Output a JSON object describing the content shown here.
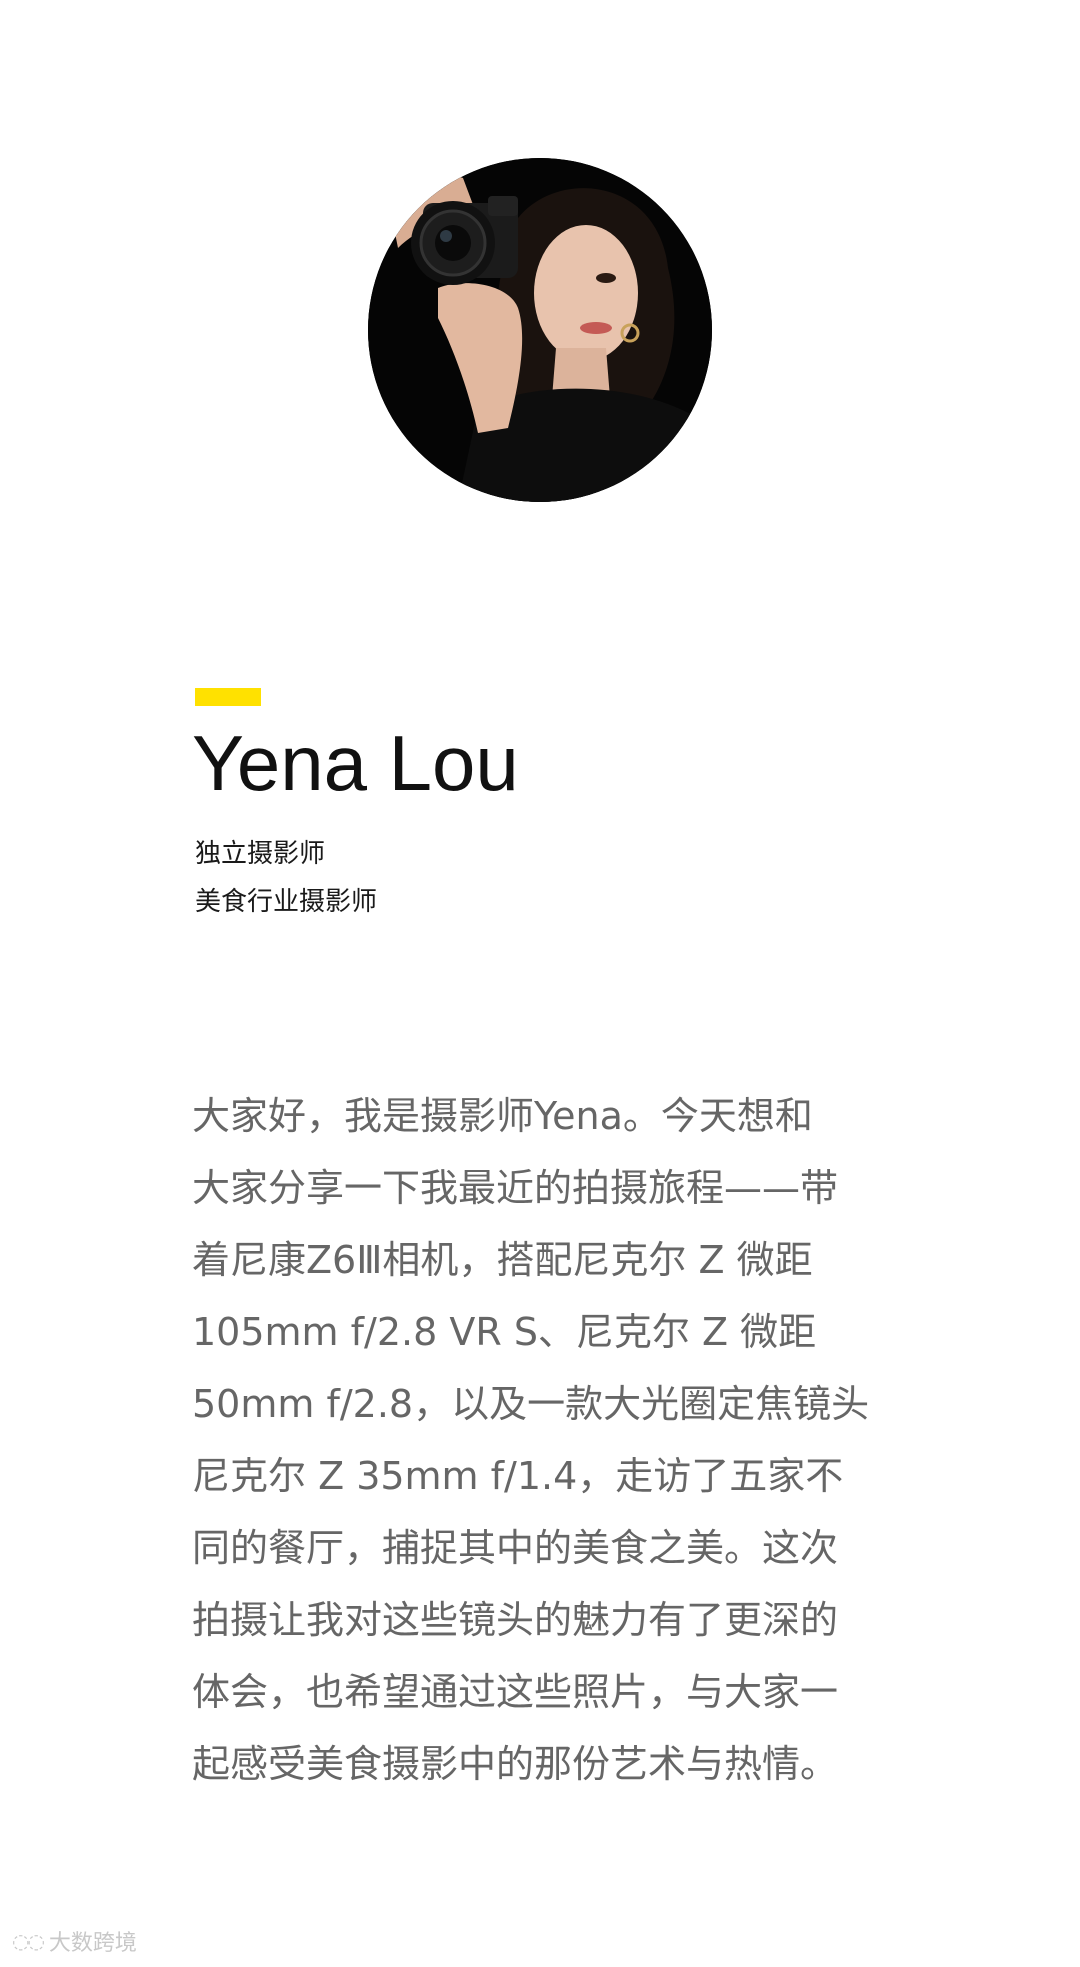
{
  "profile": {
    "name": "Yena Lou",
    "roles": [
      "独立摄影师",
      "美食行业摄影师"
    ],
    "accent_color": "#ffe100"
  },
  "intro": {
    "lines": [
      "大家好，我是摄影师Yena。今天想和",
      "大家分享一下我最近的拍摄旅程——带",
      "着尼康Z6Ⅲ相机，搭配尼克尔 Z 微距",
      "105mm f/2.8 VR S、尼克尔 Z 微距",
      "50mm f/2.8，以及一款大光圈定焦镜头",
      "尼克尔 Z 35mm f/1.4，走访了五家不",
      "同的餐厅，捕捉其中的美食之美。这次",
      "拍摄让我对这些镜头的魅力有了更深的",
      "体会，也希望通过这些照片，与大家一",
      "起感受美食摄影中的那份艺术与热情。"
    ]
  },
  "watermark": {
    "text": "大数跨境",
    "icon": "logo-icon"
  }
}
